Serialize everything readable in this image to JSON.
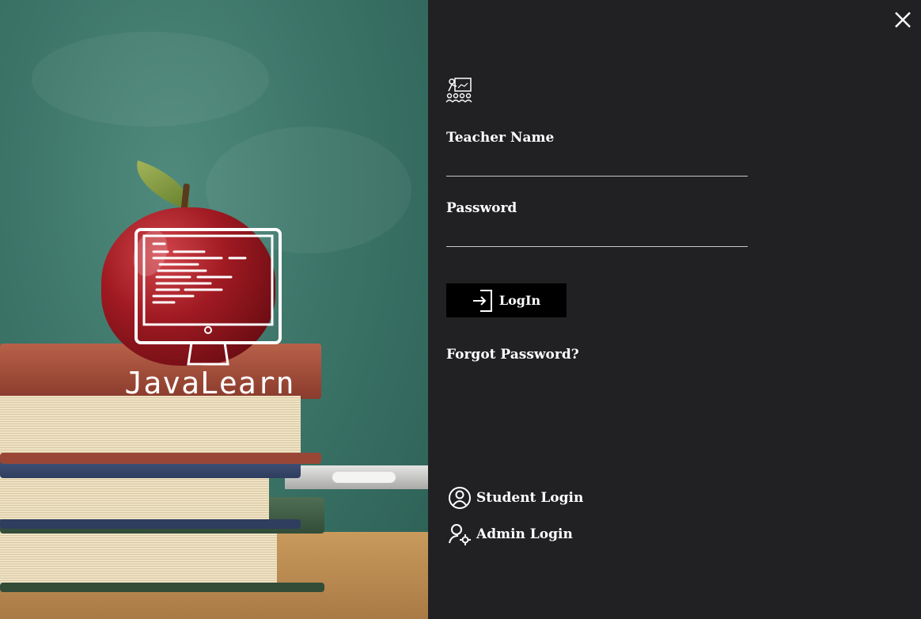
{
  "app": {
    "logo_text": "JavaLearn"
  },
  "window": {
    "close_icon": "close-icon"
  },
  "form": {
    "role_icon": "teacher-classroom-icon",
    "username_label": "Teacher Name",
    "username_value": "",
    "password_label": "Password",
    "password_value": "",
    "login_label": "LogIn",
    "login_icon": "sign-in-icon",
    "forgot_label": "Forgot Password?"
  },
  "alt_logins": [
    {
      "label": "Student Login",
      "icon": "user-circle-icon"
    },
    {
      "label": "Admin Login",
      "icon": "user-gear-icon"
    }
  ],
  "colors": {
    "panel_bg": "#212124",
    "button_bg": "#000000",
    "text": "#ffffff"
  }
}
